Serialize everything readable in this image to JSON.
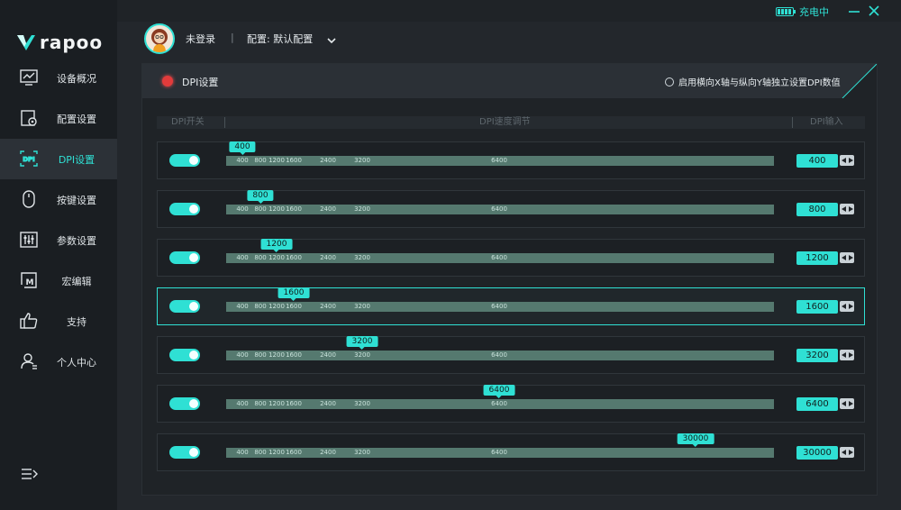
{
  "window": {
    "charge_status": "充电中"
  },
  "brand": {
    "logo_text": "rapoo"
  },
  "sidebar": {
    "items": [
      {
        "label": "设备概况",
        "icon": "monitor-chart-icon"
      },
      {
        "label": "配置设置",
        "icon": "settings-doc-icon"
      },
      {
        "label": "DPI设置",
        "icon": "dpi-icon",
        "active": true
      },
      {
        "label": "按键设置",
        "icon": "mouse-icon"
      },
      {
        "label": "参数设置",
        "icon": "sliders-icon"
      },
      {
        "label": "宏编辑",
        "icon": "macro-icon"
      },
      {
        "label": "支持",
        "icon": "thumbs-up-icon"
      },
      {
        "label": "个人中心",
        "icon": "user-icon"
      }
    ],
    "menu_icon": "collapse-menu-icon"
  },
  "header": {
    "user_name": "未登录",
    "separator": "|",
    "config_label": "配置: 默认配置"
  },
  "panel": {
    "title": "DPI设置",
    "xy_option_label": "启用横向X轴与纵向Y轴独立设置DPI数值",
    "columns": {
      "switch": "DPI开关",
      "speed": "DPI速度调节",
      "input": "DPI输入"
    },
    "tick_labels": [
      "400",
      "800",
      "1200",
      "1600",
      "2400",
      "3200",
      "6400"
    ],
    "rows": [
      {
        "enabled": true,
        "value": "400",
        "selected": false
      },
      {
        "enabled": true,
        "value": "800",
        "selected": false
      },
      {
        "enabled": true,
        "value": "1200",
        "selected": false
      },
      {
        "enabled": true,
        "value": "1600",
        "selected": true
      },
      {
        "enabled": true,
        "value": "3200",
        "selected": false
      },
      {
        "enabled": true,
        "value": "6400",
        "selected": false
      },
      {
        "enabled": true,
        "value": "30000",
        "selected": false
      }
    ]
  },
  "colors": {
    "accent": "#2fe0d4",
    "record_dot": "#e23b3b",
    "track": "#55796f"
  }
}
